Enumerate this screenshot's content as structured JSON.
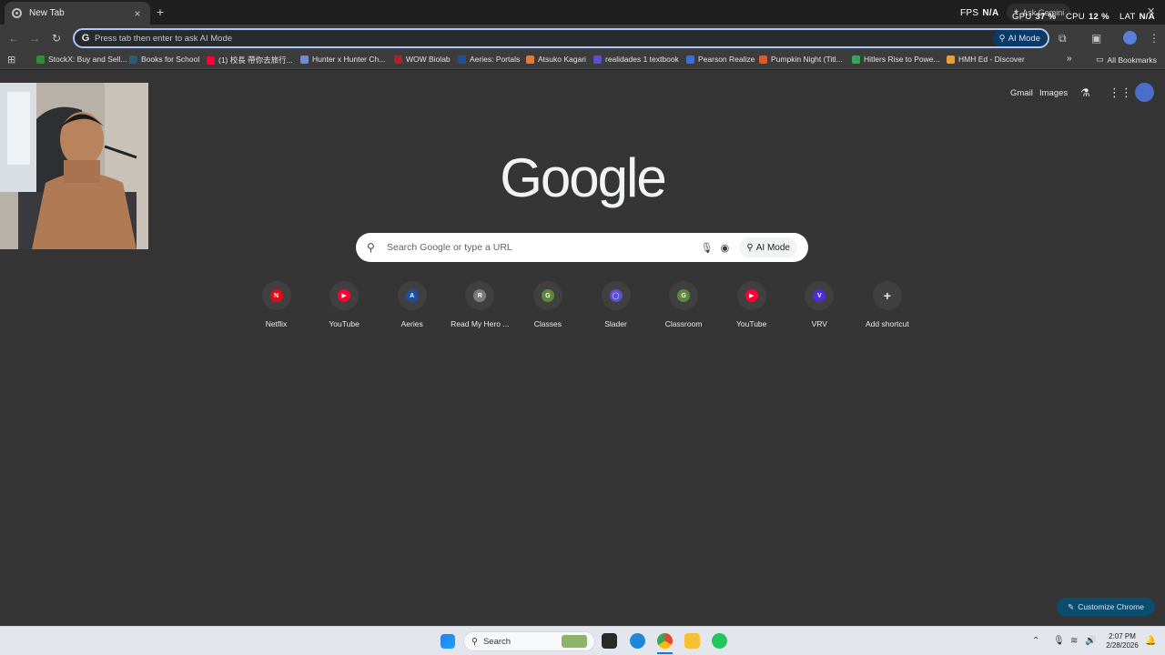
{
  "browser": {
    "tab_title": "New Tab",
    "new_tab_symbol": "+",
    "close_symbol": "×",
    "ask_gemini": "Ask Gemini",
    "omnibox_placeholder": "Press tab then enter to ask AI Mode",
    "omnibox_g": "G",
    "ai_mode_label": "AI Mode"
  },
  "overlay_stats": {
    "fps_label": "FPS",
    "fps_value": "N/A",
    "gpu_label": "GPU",
    "gpu_value": "37 %",
    "cpu_label": "CPU",
    "cpu_value": "12 %",
    "lat_label": "LAT",
    "lat_value": "N/A"
  },
  "bookmarks": {
    "items": [
      {
        "label": "StockX: Buy and Sell...",
        "color": "#2f8d3a"
      },
      {
        "label": "Books for School",
        "color": "#2e5a7a"
      },
      {
        "label": "(1) 校長 帶你去旅行...",
        "color": "#ff0033"
      },
      {
        "label": "Hunter x Hunter Ch...",
        "color": "#6c8cd5"
      },
      {
        "label": "WOW Biolab",
        "color": "#b22222"
      },
      {
        "label": "Aeries: Portals",
        "color": "#1f4e9c"
      },
      {
        "label": "Atsuko Kagari",
        "color": "#e07b39"
      },
      {
        "label": "realidades 1 textbook",
        "color": "#5a4fcf"
      },
      {
        "label": "Pearson Realize",
        "color": "#3b6fd8"
      },
      {
        "label": "Pumpkin Night (Titl...",
        "color": "#e05a2b"
      },
      {
        "label": "Hitlers Rise to Powe...",
        "color": "#34a853"
      },
      {
        "label": "HMH Ed - Discover",
        "color": "#e2a23b"
      }
    ],
    "overflow": "»",
    "all_bookmarks": "All Bookmarks"
  },
  "page": {
    "gmail": "Gmail",
    "images": "Images",
    "logo": "Google",
    "search_placeholder": "Search Google or type a URL",
    "ai_mode": "AI Mode",
    "customize": "Customize Chrome"
  },
  "shortcuts": [
    {
      "label": "Netflix",
      "glyph": "N",
      "color": "#e50914"
    },
    {
      "label": "YouTube",
      "glyph": "▶",
      "color": "#ff0033"
    },
    {
      "label": "Aeries",
      "glyph": "A",
      "color": "#1f4e9c"
    },
    {
      "label": "Read My Hero ...",
      "glyph": "R",
      "color": "#7a7a7a"
    },
    {
      "label": "Classes",
      "glyph": "G",
      "color": "#5d8a3a"
    },
    {
      "label": "Slader",
      "glyph": "◯",
      "color": "#5a4fcf"
    },
    {
      "label": "Classroom",
      "glyph": "G",
      "color": "#5d8a3a"
    },
    {
      "label": "YouTube",
      "glyph": "▶",
      "color": "#ff0033"
    },
    {
      "label": "VRV",
      "glyph": "V",
      "color": "#4f2bd8"
    },
    {
      "label": "Add shortcut",
      "glyph": "+",
      "color": "#404040"
    }
  ],
  "taskbar": {
    "search": "Search",
    "time": "2:07 PM",
    "date": "2/28/2026"
  }
}
